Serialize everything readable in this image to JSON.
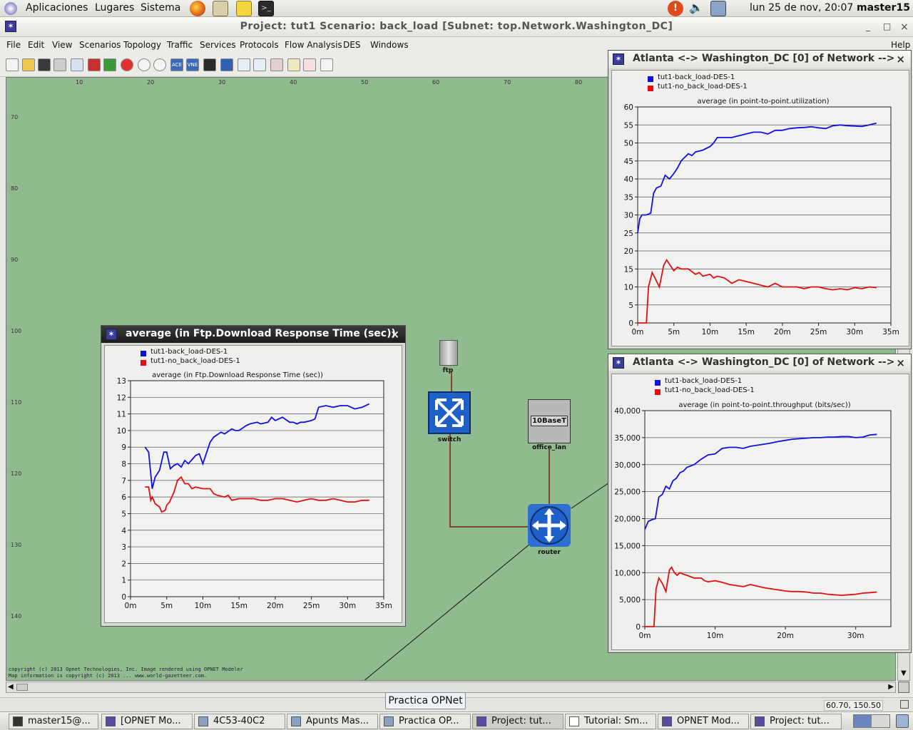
{
  "gnome": {
    "menus": [
      "Aplicaciones",
      "Lugares",
      "Sistema"
    ],
    "clock": "lun 25 de nov, 20:07",
    "user": "master15"
  },
  "window": {
    "title": "Project:  tut1 Scenario: back_load  [Subnet: top.Network.Washington_DC]",
    "min": "_",
    "max": "□",
    "close": "×"
  },
  "menubar": [
    "File",
    "Edit",
    "View",
    "Scenarios",
    "Topology",
    "Traffic",
    "Services",
    "Protocols",
    "Flow Analysis",
    "DES",
    "Windows",
    "Help"
  ],
  "toolbar": {
    "ace_label": "ACE",
    "vne_label": "VNE"
  },
  "ruler": {
    "top": [
      "10",
      "20",
      "30",
      "40",
      "50",
      "60",
      "70",
      "80"
    ],
    "left": [
      "70",
      "80",
      "90",
      "100",
      "110",
      "120",
      "130",
      "140"
    ]
  },
  "nodes": {
    "ftp": "ftp",
    "switch": "switch",
    "office_lan": "office_lan",
    "router": "router",
    "lan_badge": "10BaseT"
  },
  "copyright": [
    "copyright (c) 2013 Opnet Technologies, Inc. Image rendered using OPNET Modeler",
    "Map information is copyright (c) 2013 ... www.world-gazetteer.com."
  ],
  "colors": {
    "series_a": "#1010e0",
    "series_b": "#e01010",
    "canvas": "#90bb8e"
  },
  "graphs": {
    "ftp": {
      "window_title": "average (in Ftp.Download Response Time (sec))",
      "close": "×",
      "chart_data": {
        "type": "line",
        "title": "average (in Ftp.Download Response Time (sec))",
        "xlabel": "",
        "ylabel": "",
        "xlim": [
          0,
          35
        ],
        "ylim": [
          0,
          13
        ],
        "xticks": [
          {
            "v": 0,
            "l": "0m"
          },
          {
            "v": 5,
            "l": "5m"
          },
          {
            "v": 10,
            "l": "10m"
          },
          {
            "v": 15,
            "l": "15m"
          },
          {
            "v": 20,
            "l": "20m"
          },
          {
            "v": 25,
            "l": "25m"
          },
          {
            "v": 30,
            "l": "30m"
          },
          {
            "v": 35,
            "l": "35m"
          }
        ],
        "yticks": [
          {
            "v": 0,
            "l": "0"
          },
          {
            "v": 1,
            "l": "1"
          },
          {
            "v": 2,
            "l": "2"
          },
          {
            "v": 3,
            "l": "3"
          },
          {
            "v": 4,
            "l": "4"
          },
          {
            "v": 5,
            "l": "5"
          },
          {
            "v": 6,
            "l": "6"
          },
          {
            "v": 7,
            "l": "7"
          },
          {
            "v": 8,
            "l": "8"
          },
          {
            "v": 9,
            "l": "9"
          },
          {
            "v": 10,
            "l": "10"
          },
          {
            "v": 11,
            "l": "11"
          },
          {
            "v": 12,
            "l": "12"
          },
          {
            "v": 13,
            "l": "13"
          }
        ],
        "grid": true,
        "legend": "top-left",
        "series": [
          {
            "name": "tut1-back_load-DES-1",
            "color": "#1010e0",
            "x": [
              2,
              2.5,
              3,
              3.4,
              4,
              4.6,
              5,
              5.5,
              6,
              6.5,
              7,
              7.5,
              8,
              9,
              9.5,
              10,
              11,
              11.5,
              12.5,
              13,
              14,
              14.5,
              15,
              16,
              16.5,
              17.5,
              18,
              19,
              19.5,
              20,
              20.5,
              21,
              22,
              22.5,
              23,
              23.5,
              24,
              25,
              25.5,
              26,
              27,
              28,
              29,
              30,
              30.5,
              31,
              32,
              33
            ],
            "y": [
              9.0,
              8.7,
              6.5,
              7.2,
              7.6,
              8.7,
              8.7,
              7.7,
              7.9,
              8.0,
              7.8,
              8.2,
              8.0,
              8.5,
              8.6,
              8.0,
              9.3,
              9.6,
              9.9,
              9.8,
              10.1,
              10.0,
              10.0,
              10.3,
              10.4,
              10.5,
              10.4,
              10.5,
              10.8,
              10.6,
              10.7,
              10.8,
              10.5,
              10.5,
              10.4,
              10.5,
              10.5,
              10.6,
              10.7,
              11.4,
              11.5,
              11.4,
              11.5,
              11.5,
              11.4,
              11.3,
              11.4,
              11.6
            ]
          },
          {
            "name": "tut1-no_back_load-DES-1",
            "color": "#e01010",
            "x": [
              2,
              2.5,
              2.8,
              3,
              3.4,
              4,
              4.3,
              4.8,
              5,
              5.4,
              6,
              6.5,
              7,
              7.5,
              8,
              8.5,
              9,
              10,
              11,
              11.5,
              12,
              13,
              13.5,
              14,
              15,
              16,
              17,
              18,
              18.5,
              19,
              20,
              21,
              22,
              23,
              24,
              25,
              26,
              27,
              28,
              29,
              30,
              31,
              32,
              33
            ],
            "y": [
              6.6,
              6.6,
              5.8,
              6.0,
              5.6,
              5.4,
              5.1,
              5.2,
              5.5,
              5.7,
              6.3,
              7.0,
              7.2,
              6.8,
              6.8,
              6.5,
              6.6,
              6.5,
              6.5,
              6.2,
              6.1,
              6.0,
              6.1,
              5.8,
              5.9,
              5.9,
              5.9,
              5.8,
              5.8,
              5.8,
              5.9,
              5.9,
              5.8,
              5.7,
              5.8,
              5.9,
              5.8,
              5.8,
              5.9,
              5.8,
              5.7,
              5.7,
              5.8,
              5.8
            ]
          }
        ]
      }
    },
    "util": {
      "window_title": "Atlanta <-> Washington_DC [0] of Network -->",
      "close": "×",
      "chart_data": {
        "type": "line",
        "title": "average (in point-to-point.utilization)",
        "xlabel": "",
        "ylabel": "",
        "xlim": [
          0,
          35
        ],
        "ylim": [
          0,
          60
        ],
        "xticks": [
          {
            "v": 0,
            "l": "0m"
          },
          {
            "v": 5,
            "l": "5m"
          },
          {
            "v": 10,
            "l": "10m"
          },
          {
            "v": 15,
            "l": "15m"
          },
          {
            "v": 20,
            "l": "20m"
          },
          {
            "v": 25,
            "l": "25m"
          },
          {
            "v": 30,
            "l": "30m"
          },
          {
            "v": 35,
            "l": "35m"
          }
        ],
        "yticks": [
          {
            "v": 0,
            "l": "0"
          },
          {
            "v": 5,
            "l": "5"
          },
          {
            "v": 10,
            "l": "10"
          },
          {
            "v": 15,
            "l": "15"
          },
          {
            "v": 20,
            "l": "20"
          },
          {
            "v": 25,
            "l": "25"
          },
          {
            "v": 30,
            "l": "30"
          },
          {
            "v": 35,
            "l": "35"
          },
          {
            "v": 40,
            "l": "40"
          },
          {
            "v": 45,
            "l": "45"
          },
          {
            "v": 50,
            "l": "50"
          },
          {
            "v": 55,
            "l": "55"
          },
          {
            "v": 60,
            "l": "60"
          }
        ],
        "grid": true,
        "legend": "top-left",
        "series": [
          {
            "name": "tut1-back_load-DES-1",
            "color": "#1010e0",
            "x": [
              0,
              0.3,
              0.6,
              1.2,
              1.8,
              2.2,
              2.6,
              3.2,
              3.8,
              4.4,
              5,
              5.5,
              6,
              6.5,
              7,
              7.5,
              8,
              9,
              10,
              10.5,
              11,
              11.5,
              12,
              13,
              14,
              15,
              16,
              17,
              18,
              19,
              20,
              21,
              22,
              23,
              24,
              25,
              26,
              27,
              28,
              29,
              30,
              31,
              32,
              33
            ],
            "y": [
              25,
              29,
              30,
              30,
              30.5,
              36,
              37.5,
              38,
              41,
              40,
              41.5,
              43,
              45,
              46,
              47,
              46.5,
              47.5,
              48,
              49,
              50,
              51.5,
              51.5,
              51.5,
              51.5,
              52,
              52.5,
              53,
              53,
              52.5,
              53.5,
              53.5,
              54,
              54.2,
              54.3,
              54.5,
              54.2,
              54.0,
              54.8,
              55.0,
              54.8,
              54.7,
              54.6,
              55.0,
              55.5
            ]
          },
          {
            "name": "tut1-no_back_load-DES-1",
            "color": "#e01010",
            "x": [
              0,
              1.2,
              1.5,
              2,
              2.5,
              3,
              3.6,
              4,
              4.5,
              5,
              5.5,
              6,
              7,
              8,
              8.5,
              9,
              10,
              10.5,
              11,
              12,
              13,
              14,
              15,
              16,
              17,
              18,
              19,
              20,
              21,
              22,
              23,
              24,
              25,
              26,
              27,
              28,
              29,
              30,
              31,
              32,
              33
            ],
            "y": [
              0,
              0,
              10,
              14,
              12,
              10,
              16,
              17.5,
              16,
              14.5,
              15.5,
              15,
              15,
              13.5,
              14,
              13,
              13.5,
              12.5,
              13,
              12.5,
              11,
              12,
              11.5,
              11,
              10.5,
              10,
              11,
              10,
              10,
              10,
              9.5,
              10,
              10,
              9.5,
              9.2,
              9.5,
              9.2,
              9.8,
              9.5,
              10.0,
              9.8
            ]
          }
        ]
      }
    },
    "thru": {
      "window_title": "Atlanta <-> Washington_DC [0] of Network -->",
      "close": "×",
      "chart_data": {
        "type": "line",
        "title": "average (in point-to-point.throughput (bits/sec))",
        "xlabel": "",
        "ylabel": "",
        "xlim": [
          0,
          35
        ],
        "ylim": [
          0,
          40000
        ],
        "xticks": [
          {
            "v": 0,
            "l": "0m"
          },
          {
            "v": 10,
            "l": "10m"
          },
          {
            "v": 20,
            "l": "20m"
          },
          {
            "v": 30,
            "l": "30m"
          }
        ],
        "yticks": [
          {
            "v": 0,
            "l": "0"
          },
          {
            "v": 5000,
            "l": "5,000"
          },
          {
            "v": 10000,
            "l": "10,000"
          },
          {
            "v": 15000,
            "l": "15,000"
          },
          {
            "v": 20000,
            "l": "20,000"
          },
          {
            "v": 25000,
            "l": "25,000"
          },
          {
            "v": 30000,
            "l": "30,000"
          },
          {
            "v": 35000,
            "l": "35,000"
          },
          {
            "v": 40000,
            "l": "40,000"
          }
        ],
        "grid": true,
        "legend": "top-left",
        "series": [
          {
            "name": "tut1-back_load-DES-1",
            "color": "#1010e0",
            "x": [
              0,
              0.5,
              1,
              1.5,
              2,
              2.5,
              3,
              3.5,
              4,
              4.5,
              5,
              5.5,
              6,
              7,
              8,
              9,
              10,
              11,
              12,
              13,
              14,
              15,
              16,
              17,
              18,
              19,
              20,
              21,
              22,
              23,
              24,
              25,
              26,
              27,
              28,
              29,
              30,
              31,
              32,
              33
            ],
            "y": [
              18000,
              19500,
              19800,
              20000,
              24000,
              24500,
              26000,
              25500,
              27000,
              27500,
              28500,
              28800,
              29500,
              30000,
              31000,
              31800,
              32000,
              33000,
              33200,
              33200,
              33000,
              33400,
              33600,
              33800,
              34000,
              34300,
              34500,
              34700,
              34800,
              34900,
              35000,
              35000,
              35100,
              35100,
              35200,
              35200,
              35000,
              35100,
              35500,
              35600
            ]
          },
          {
            "name": "tut1-no_back_load-DES-1",
            "color": "#e01010",
            "x": [
              0,
              1.3,
              1.6,
              2,
              2.5,
              3,
              3.5,
              3.8,
              4.2,
              4.6,
              5,
              5.5,
              6,
              7,
              8,
              8.5,
              9,
              10,
              11,
              12,
              13,
              14,
              15,
              16,
              17,
              18,
              19,
              20,
              21,
              22,
              23,
              24,
              25,
              26,
              27,
              28,
              29,
              30,
              31,
              32,
              33
            ],
            "y": [
              0,
              0,
              7000,
              9000,
              8000,
              6500,
              10500,
              11000,
              10000,
              9500,
              10000,
              9700,
              9500,
              9000,
              9000,
              8500,
              8300,
              8500,
              8200,
              7800,
              7600,
              7400,
              7800,
              7500,
              7200,
              7000,
              6800,
              6600,
              6500,
              6500,
              6400,
              6200,
              6200,
              6000,
              5900,
              5800,
              5900,
              6000,
              6200,
              6300,
              6400
            ]
          }
        ]
      }
    }
  },
  "status": {
    "tooltip": "Practica OPNet",
    "coords": "60.70, 150.50"
  },
  "taskbar": [
    {
      "label": "master15@...",
      "active": false
    },
    {
      "label": "[OPNET Mo...",
      "active": false
    },
    {
      "label": "4C53-40C2",
      "active": false
    },
    {
      "label": "Apunts Mas...",
      "active": false
    },
    {
      "label": "Practica OP...",
      "active": false
    },
    {
      "label": "Project: tut...",
      "active": true
    },
    {
      "label": "Tutorial: Sm...",
      "active": false
    },
    {
      "label": "OPNET Mod...",
      "active": false
    },
    {
      "label": "Project: tut...",
      "active": false
    }
  ]
}
